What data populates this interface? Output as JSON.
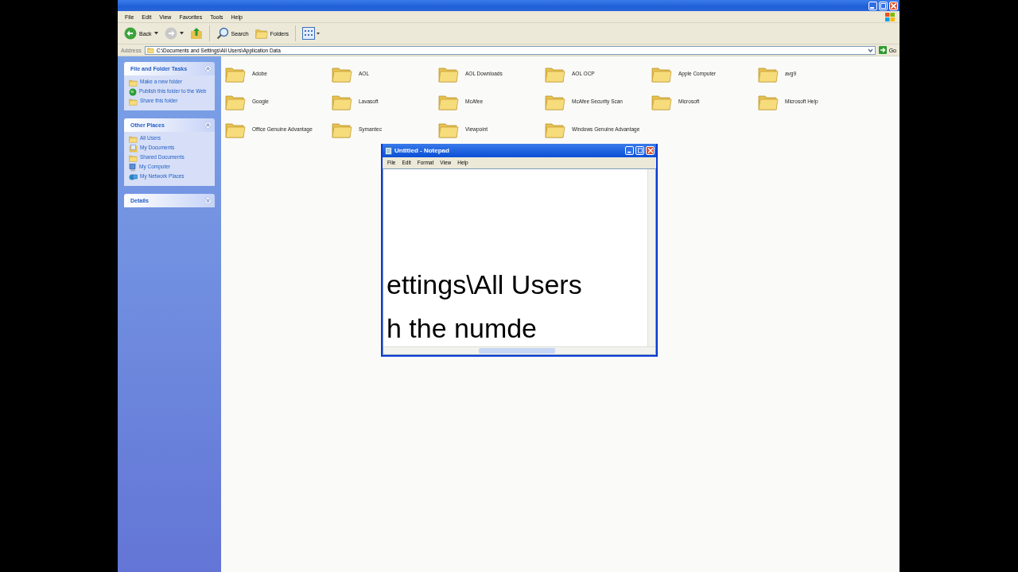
{
  "menu": [
    "File",
    "Edit",
    "View",
    "Favorites",
    "Tools",
    "Help"
  ],
  "toolbar": [
    {
      "kind": "back",
      "label": "Back"
    },
    {
      "kind": "forward"
    },
    {
      "kind": "up"
    },
    {
      "kind": "search",
      "label": "Search"
    },
    {
      "kind": "folders",
      "label": "Folders"
    },
    {
      "kind": "views"
    }
  ],
  "address": {
    "label": "Address",
    "value": "C:\\Documents and Settings\\All Users\\Application Data",
    "go": "Go"
  },
  "sidebar": [
    {
      "title": "File and Folder Tasks",
      "expanded": true,
      "items": [
        {
          "kind": "new-folder",
          "label": "Make a new folder"
        },
        {
          "kind": "publish",
          "label": "Publish this folder to the Web"
        },
        {
          "kind": "share",
          "label": "Share this folder"
        }
      ]
    },
    {
      "title": "Other Places",
      "expanded": true,
      "items": [
        {
          "kind": "folder",
          "label": "All Users"
        },
        {
          "kind": "documents",
          "label": "My Documents"
        },
        {
          "kind": "folder",
          "label": "Shared Documents"
        },
        {
          "kind": "computer",
          "label": "My Computer"
        },
        {
          "kind": "network",
          "label": "My Network Places"
        }
      ]
    },
    {
      "title": "Details",
      "expanded": false
    }
  ],
  "folders": [
    "Adobe",
    "AOL",
    "AOL Downloads",
    "AOL OCP",
    "Apple Computer",
    "avg9",
    "Google",
    "Lavasoft",
    "McAfee",
    "McAfee Security Scan",
    "Microsoft",
    "Microsoft Help",
    "Office Genuine Advantage",
    "Symantec",
    "Viewpoint",
    "Windows Genuine Advantage"
  ],
  "notepad": {
    "title": "Untitled - Notepad",
    "menu": [
      "File",
      "Edit",
      "Format",
      "View",
      "Help"
    ],
    "lines": [
      "ettings\\All Users",
      "h the numde"
    ]
  }
}
